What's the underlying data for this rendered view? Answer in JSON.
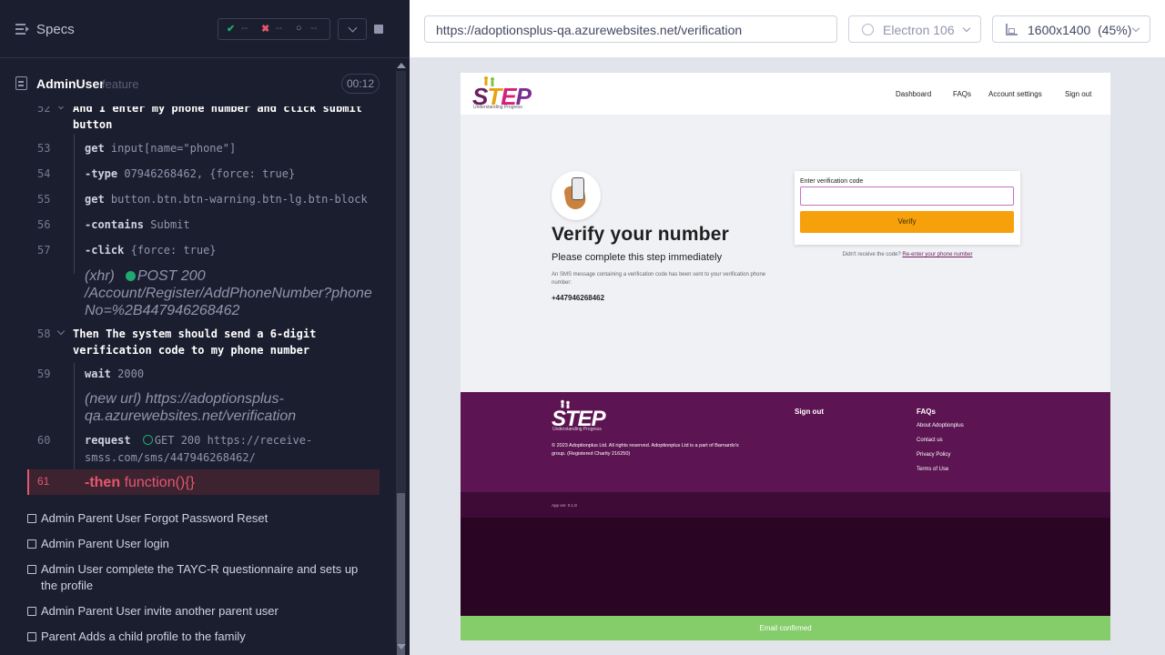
{
  "reporter": {
    "title": "Specs",
    "stats": {
      "passed": "--",
      "failed": "--",
      "pending": "--"
    },
    "spec": {
      "name": "AdminUser",
      "ext": "feature",
      "duration": "00:12"
    },
    "header_step": {
      "num": "52",
      "keyword": "And",
      "text": "I enter my phone number and click submit button"
    },
    "commands": [
      {
        "num": "53",
        "name": "get",
        "arg": "input[name=\"phone\"]"
      },
      {
        "num": "54",
        "name": "-type",
        "arg": "07946268462, {force: true}"
      },
      {
        "num": "55",
        "name": "get",
        "arg": "button.btn.btn-warning.btn-lg.btn-block"
      },
      {
        "num": "56",
        "name": "-contains",
        "arg": "Submit"
      },
      {
        "num": "57",
        "name": "-click",
        "arg": "{force: true}"
      }
    ],
    "xhr_log": {
      "label": "(xhr)",
      "method": "POST 200",
      "url": "/Account/Register/AddPhoneNumber?phoneNo=%2B447946268462"
    },
    "then_step": {
      "num": "58",
      "keyword": "Then",
      "text": "The system should send a 6-digit verification code to my phone number"
    },
    "wait_cmd": {
      "num": "59",
      "name": "wait",
      "arg": "2000"
    },
    "url_log": {
      "label": "(new url)",
      "url": "https://adoptionsplus-qa.azurewebsites.net/verification"
    },
    "request_cmd": {
      "num": "60",
      "name": "request",
      "status": "GET 200",
      "url": "https://receive-smss.com/sms/447946268462/"
    },
    "failed_cmd": {
      "num": "61",
      "name": "-then",
      "arg": "function(){}"
    },
    "tests": [
      "Admin Parent User Forgot Password Reset",
      "Admin Parent User login",
      "Admin User complete the TAYC-R questionnaire and sets up the profile",
      "Admin Parent User invite another parent user",
      "Parent Adds a child profile to the family"
    ]
  },
  "browser": {
    "url": "https://adoptionsplus-qa.azurewebsites.net/verification",
    "engine": "Electron 106",
    "viewport": "1600x1400  (45%)"
  },
  "site": {
    "logo": "STEP",
    "logo_sub": "Understanding Progress",
    "nav": [
      "Dashboard",
      "FAQs",
      "Account settings",
      "Sign out"
    ],
    "title": "Verify your number",
    "subtitle": "Please complete this step immediately",
    "description": "An SMS message containing a verification code has been sent to your verification phone number:",
    "phone": "+447946268462",
    "code_label": "Enter verification code",
    "verify_button": "Verify",
    "resend_text": "Didn't receive the code?",
    "resend_link": "Re-enter your phone number",
    "footer": {
      "copyright": "© 2023 Adoptionplus Ltd. All rights reserved. Adoptionplus Ltd is a part of Barnardo's group. (Registered Charity 216250)",
      "signout": "Sign out",
      "faqs": "FAQs",
      "links": [
        "About Adoptionplus",
        "Contact us",
        "Privacy Policy",
        "Terms of Use"
      ],
      "app_version": "App ver. 0.1.8"
    },
    "toast": "Email confirmed"
  },
  "colors": {
    "reporter_bg": "#1b1e2e",
    "pass": "#1fa971",
    "fail": "#e45770",
    "footer": "#5c1552",
    "verify_button": "#f6a00c",
    "toast": "#85cc6a"
  }
}
